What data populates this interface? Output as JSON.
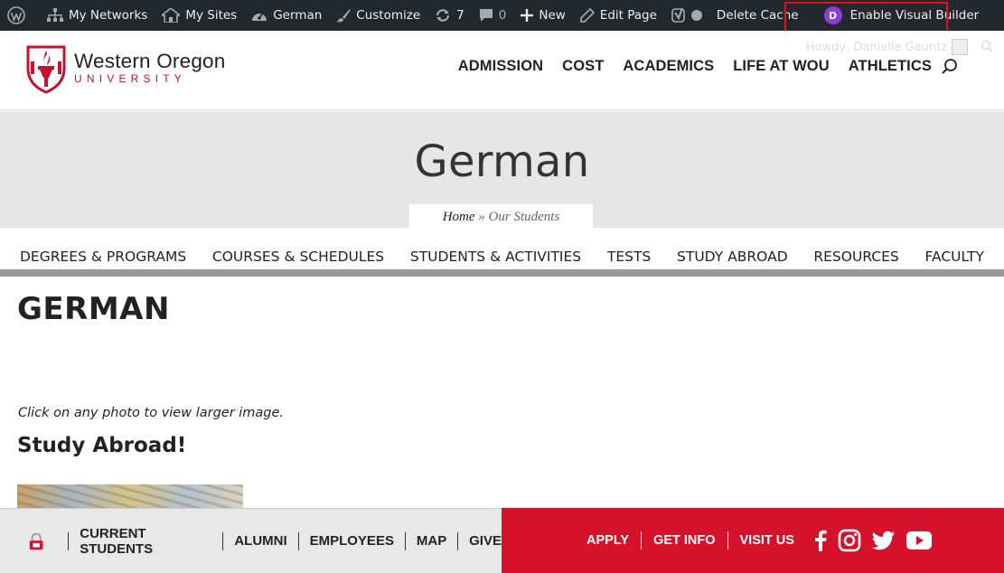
{
  "adminbar": {
    "items": [
      {
        "label": "My Networks"
      },
      {
        "label": "My Sites"
      },
      {
        "label": "German"
      },
      {
        "label": "Customize"
      },
      {
        "label": "7"
      },
      {
        "label": "0"
      },
      {
        "label": "New"
      },
      {
        "label": "Edit Page"
      },
      {
        "label": "Delete Cache"
      },
      {
        "label": "Enable Visual Builder"
      }
    ],
    "divi_letter": "D",
    "highlight_color": "#e0141b"
  },
  "header": {
    "logo_title": "Western Oregon",
    "logo_sub": "UNIVERSITY",
    "howdy": "Howdy, Danielle Gauntz",
    "nav": [
      "ADMISSION",
      "COST",
      "ACADEMICS",
      "LIFE AT WOU",
      "ATHLETICS"
    ],
    "brand_color": "#c8102e"
  },
  "title_band": {
    "title": "German",
    "crumb_home": "Home",
    "crumb_sep": "»",
    "crumb_current": "Our Students"
  },
  "subnav": [
    "DEGREES & PROGRAMS",
    "COURSES & SCHEDULES",
    "STUDENTS & ACTIVITIES",
    "TESTS",
    "STUDY ABROAD",
    "RESOURCES",
    "FACULTY"
  ],
  "content": {
    "heading": "GERMAN",
    "note": "Click on any photo to view larger image.",
    "subheading": "Study Abroad!"
  },
  "footer": {
    "left_links": [
      "CURRENT STUDENTS",
      "ALUMNI",
      "EMPLOYEES",
      "MAP",
      "GIVE"
    ],
    "right_links": [
      "APPLY",
      "GET INFO",
      "VISIT US"
    ],
    "socials": [
      "facebook-icon",
      "instagram-icon",
      "twitter-icon",
      "youtube-icon"
    ],
    "red": "#d6112c"
  }
}
